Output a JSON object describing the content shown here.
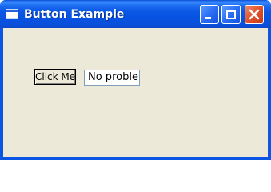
{
  "window": {
    "title": "Button Example",
    "controls": {
      "minimize": "minimize-icon",
      "maximize": "maximize-icon",
      "close": "close-icon"
    },
    "colors": {
      "titlebar": "#0a58e6",
      "client_background": "#ece9d8",
      "close_button": "#e2512a"
    }
  },
  "content": {
    "button_label": "Click Me",
    "text_value": "No proble"
  }
}
